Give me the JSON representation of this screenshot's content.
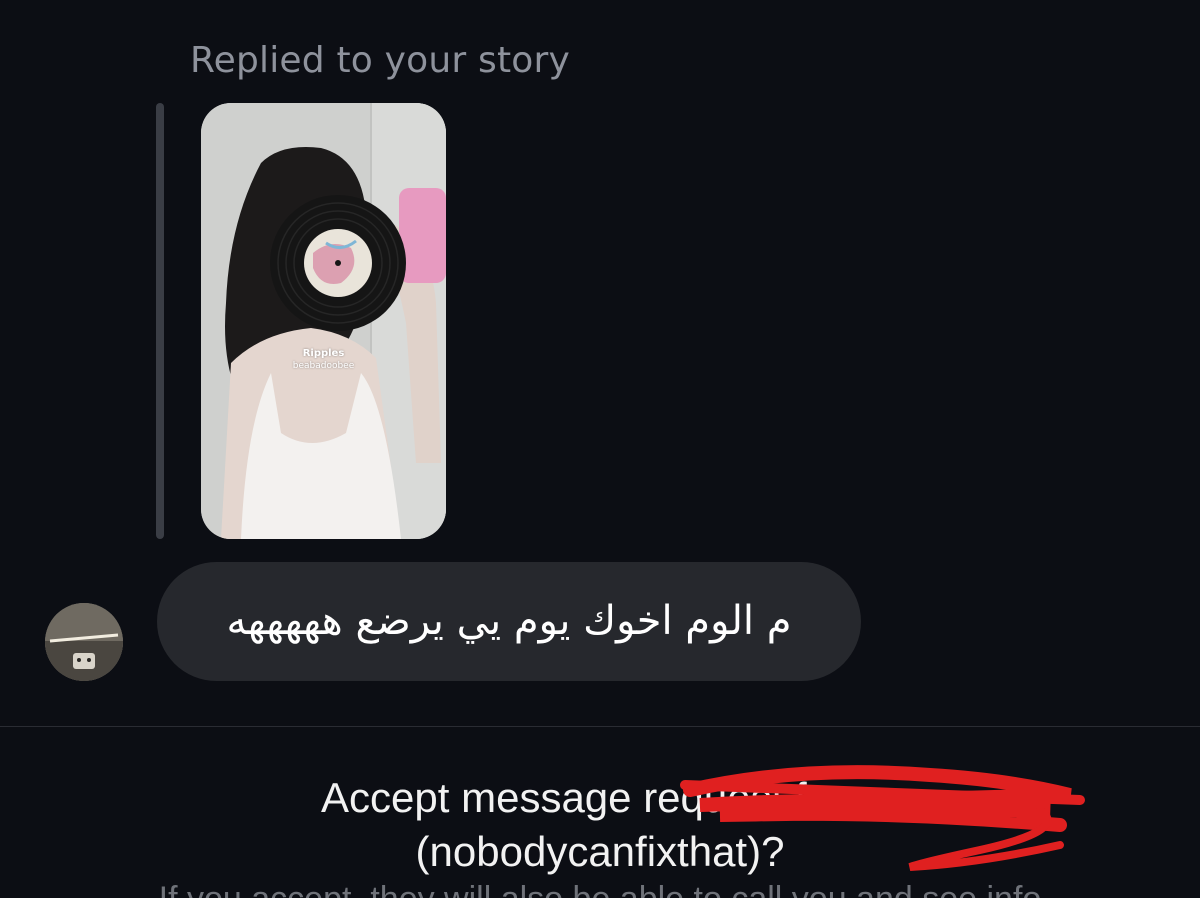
{
  "story_reply": {
    "label": "Replied to your story",
    "music_sticker": {
      "title": "Ripples",
      "artist": "beabadoobee"
    }
  },
  "message": {
    "text": "م الوم اخوك يوم يي يرضع هههههه"
  },
  "request": {
    "prompt_prefix": "Accept message request from",
    "username": "(nobodycanfixthat)?",
    "info_text_cutoff": "If you accept, they will also be able to call you and see info"
  },
  "colors": {
    "background": "#0c0e14",
    "bubble": "#26282d",
    "scribble": "#e02020"
  }
}
